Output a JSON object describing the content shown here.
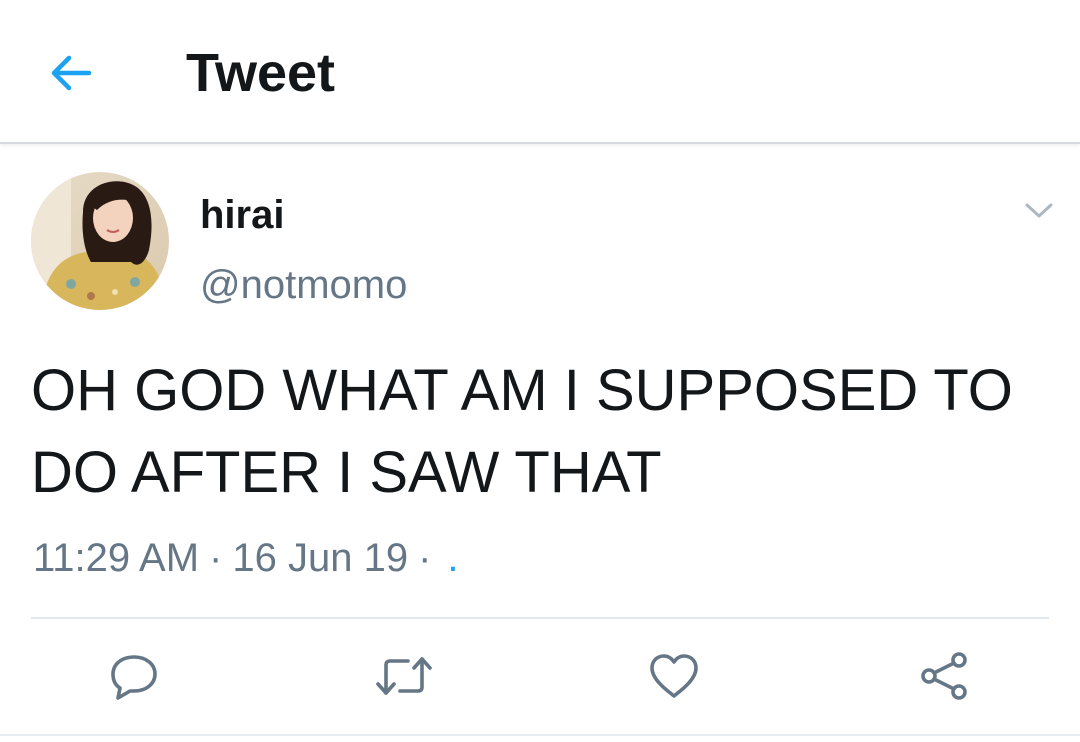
{
  "header": {
    "title": "Tweet",
    "back_icon": "arrow-left-icon"
  },
  "tweet": {
    "author": {
      "display_name": "hirai",
      "handle": "@notmomo",
      "avatar_icon": "profile-photo"
    },
    "text": "OH GOD WHAT AM I SUPPOSED TO DO AFTER I SAW THAT",
    "time": "11:29 AM",
    "separator": "·",
    "date": "16 Jun 19",
    "source": "."
  },
  "actions": [
    {
      "name": "reply",
      "icon": "speech-bubble-icon"
    },
    {
      "name": "retweet",
      "icon": "retweet-icon"
    },
    {
      "name": "like",
      "icon": "heart-icon"
    },
    {
      "name": "share",
      "icon": "share-icon"
    }
  ],
  "colors": {
    "accent": "#1da1f2",
    "text": "#14171a",
    "secondary_text": "#657786",
    "divider": "#e1e8ed"
  }
}
